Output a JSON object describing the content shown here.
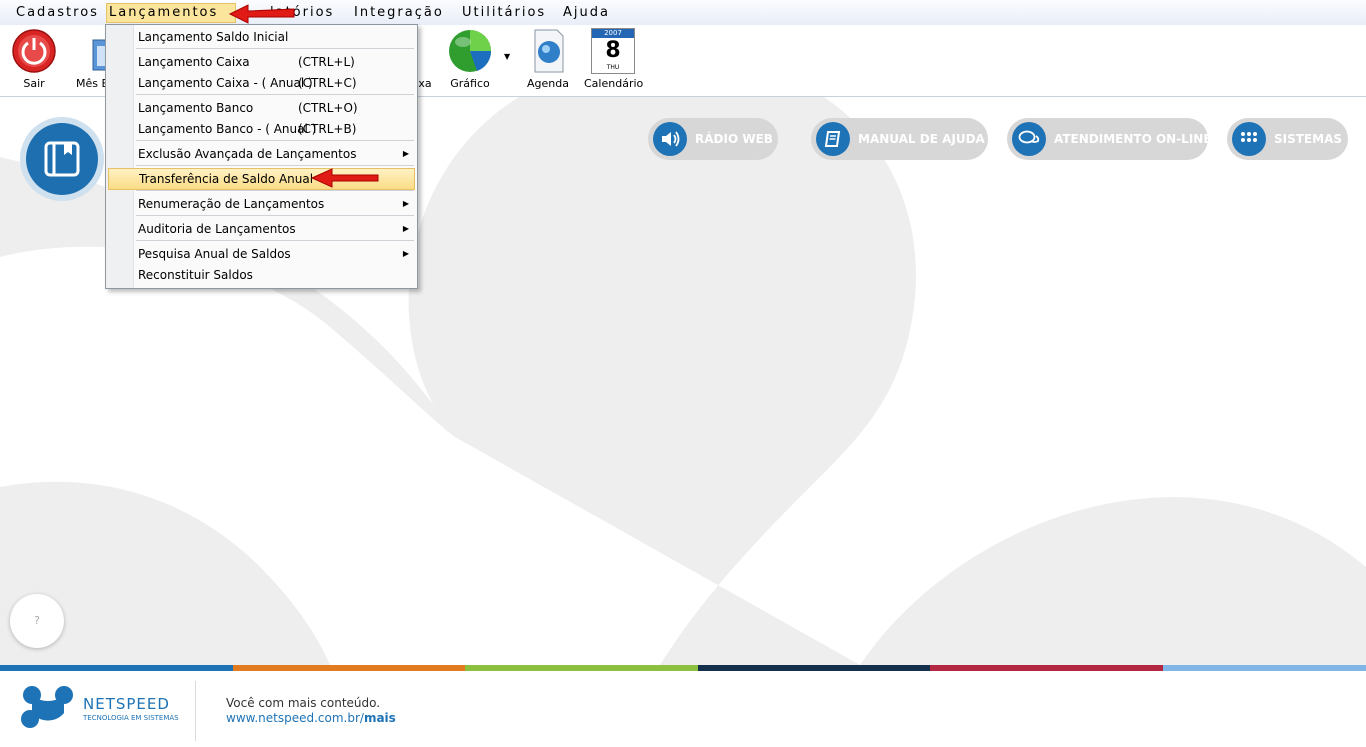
{
  "menubar": {
    "items": [
      {
        "label": "Cadastros"
      },
      {
        "label": "Lançamentos"
      },
      {
        "label": "latórios"
      },
      {
        "label": "Integração"
      },
      {
        "label": "Utilitários"
      },
      {
        "label": "Ajuda"
      }
    ]
  },
  "toolbar": {
    "sair": "Sair",
    "mes": "Mês B",
    "caixa": "xa",
    "grafico": "Gráfico",
    "agenda": "Agenda",
    "calendario": "Calendário",
    "calendar_day": "8",
    "calendar_year": "2007",
    "calendar_weekday": "THU"
  },
  "dropdown": {
    "items": [
      {
        "label": "Lançamento Saldo Inicial",
        "shortcut": ""
      },
      {
        "label": "Lançamento Caixa",
        "shortcut": "(CTRL+L)"
      },
      {
        "label": "Lançamento Caixa - ( Anual )",
        "shortcut": "(CTRL+C)"
      },
      {
        "label": "Lançamento Banco",
        "shortcut": "(CTRL+O)"
      },
      {
        "label": "Lançamento Banco - ( Anual )",
        "shortcut": "(CTRL+B)"
      },
      {
        "label": "Exclusão Avançada de Lançamentos",
        "shortcut": ""
      },
      {
        "label": "Transferência de Saldo Anual",
        "shortcut": ""
      },
      {
        "label": "Renumeração de Lançamentos",
        "shortcut": ""
      },
      {
        "label": "Auditoria de Lançamentos",
        "shortcut": ""
      },
      {
        "label": "Pesquisa Anual de Saldos",
        "shortcut": ""
      },
      {
        "label": "Reconstituir Saldos",
        "shortcut": ""
      }
    ]
  },
  "links": {
    "radio": "RÁDIO WEB",
    "manual": "MANUAL DE AJUDA",
    "atendimento": "ATENDIMENTO ON-LINE",
    "sistemas": "SISTEMAS"
  },
  "help_bubble": "?",
  "footer": {
    "brand": "NETSPEED",
    "brand_sub": "TECNOLOGIA EM SISTEMAS",
    "tagline": "Você com mais conteúdo.",
    "url_prefix": "www.netspeed.com.br/",
    "url_bold": "mais"
  },
  "colors": {
    "accent_blue": "#1e73b6",
    "highlight": "#fbdc86",
    "bar": [
      "#1e73b6",
      "#e07b1f",
      "#8dc03f",
      "#15304a",
      "#b32743",
      "#7fb6e6"
    ]
  }
}
